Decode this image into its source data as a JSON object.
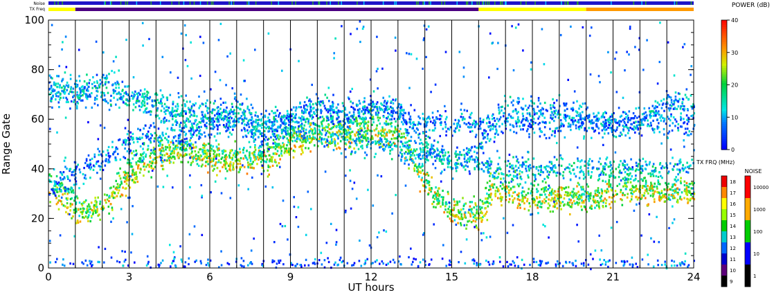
{
  "chart_data": {
    "type": "heatmap",
    "xlabel": "UT hours",
    "ylabel": "Range Gate",
    "xlim": [
      0,
      24
    ],
    "ylim": [
      0,
      100
    ],
    "x_ticks": [
      0,
      3,
      6,
      9,
      12,
      15,
      18,
      21,
      24
    ],
    "x_tick_labels": [
      "0",
      "3",
      "6",
      "9",
      "12",
      "15",
      "18",
      "21",
      "24"
    ],
    "y_ticks": [
      0,
      20,
      40,
      60,
      80,
      100
    ],
    "y_tick_labels": [
      "0",
      "20",
      "40",
      "60",
      "80",
      "100"
    ],
    "hour_lines": [
      1,
      2,
      3,
      4,
      5,
      6,
      7,
      8,
      9,
      10,
      11,
      12,
      13,
      14,
      15,
      16,
      17,
      18,
      19,
      20,
      21,
      22,
      23
    ],
    "grid": false,
    "legend_position": "right",
    "top_bars": {
      "noise_label": "Noise",
      "txfreq_label": "TX Freq",
      "tx_segments": [
        {
          "from": 0,
          "to": 1,
          "color": "#ffff00"
        },
        {
          "from": 1,
          "to": 16,
          "color": "#4b0082"
        },
        {
          "from": 16,
          "to": 20,
          "color": "#ffff00"
        },
        {
          "from": 20,
          "to": 24,
          "color": "#ff9900"
        }
      ]
    },
    "power_colorbar": {
      "title": "POWER (dB)",
      "range": [
        0,
        40
      ],
      "ticks": [
        0,
        10,
        20,
        30,
        40
      ],
      "tick_labels": [
        "0",
        "10",
        "20",
        "30",
        "40"
      ]
    },
    "txfreq_colorbar": {
      "title": "TX FRQ (MHz)",
      "labels": [
        "9",
        "10",
        "11",
        "12",
        "13",
        "14",
        "15",
        "16",
        "17",
        "18"
      ],
      "colors": [
        "#000000",
        "#5c007a",
        "#0000cc",
        "#0066ff",
        "#00cccc",
        "#00cc00",
        "#99ff00",
        "#ffff00",
        "#ff8800",
        "#ee0000"
      ]
    },
    "noise_colorbar": {
      "title": "NOISE",
      "labels": [
        "1",
        "10",
        "100",
        "1000",
        "10000"
      ],
      "colors": [
        "#000000",
        "#0000ff",
        "#00cc00",
        "#ffaa00",
        "#ff0000"
      ]
    },
    "backscatter_bands": [
      {
        "name": "band_a",
        "points": [
          [
            0,
            70
          ],
          [
            1,
            68
          ],
          [
            2,
            76
          ],
          [
            3,
            70
          ],
          [
            4,
            64
          ],
          [
            5,
            57
          ],
          [
            6,
            62
          ],
          [
            7,
            64
          ],
          [
            8,
            58
          ],
          [
            9,
            60
          ],
          [
            10,
            66
          ],
          [
            11,
            62
          ],
          [
            12,
            64
          ],
          [
            13,
            62
          ],
          [
            14,
            50
          ],
          [
            15,
            42
          ],
          [
            16,
            48
          ],
          [
            17,
            66
          ],
          [
            18,
            64
          ],
          [
            19,
            64
          ],
          [
            20,
            62
          ],
          [
            21,
            58
          ],
          [
            22,
            60
          ],
          [
            23,
            66
          ],
          [
            24,
            66
          ]
        ],
        "power": 10
      },
      {
        "name": "band_b",
        "points": [
          [
            0,
            36
          ],
          [
            0.5,
            32
          ],
          [
            1,
            26
          ],
          [
            1.5,
            22
          ],
          [
            2,
            26
          ],
          [
            3,
            42
          ],
          [
            4,
            48
          ],
          [
            5,
            48
          ],
          [
            6,
            46
          ],
          [
            7,
            44
          ],
          [
            8,
            46
          ],
          [
            9,
            54
          ],
          [
            10,
            58
          ],
          [
            11,
            56
          ],
          [
            12,
            58
          ],
          [
            13,
            56
          ],
          [
            13.5,
            46
          ],
          [
            14,
            36
          ],
          [
            14.5,
            28
          ],
          [
            15,
            24
          ],
          [
            15.5,
            22
          ],
          [
            16,
            24
          ],
          [
            16.5,
            34
          ],
          [
            17,
            34
          ],
          [
            18,
            30
          ],
          [
            19,
            30
          ],
          [
            20,
            30
          ],
          [
            20.5,
            28
          ],
          [
            21,
            36
          ],
          [
            22,
            34
          ],
          [
            23,
            32
          ],
          [
            24,
            32
          ]
        ],
        "power": 18
      },
      {
        "name": "band_c",
        "points": [
          [
            0,
            32
          ],
          [
            1,
            22
          ],
          [
            2,
            24
          ],
          [
            3,
            36
          ],
          [
            4,
            44
          ],
          [
            5,
            46
          ],
          [
            6,
            44
          ],
          [
            7,
            42
          ],
          [
            8,
            42
          ],
          [
            9,
            50
          ],
          [
            10,
            54
          ],
          [
            11,
            52
          ],
          [
            12,
            54
          ],
          [
            13,
            52
          ],
          [
            14,
            34
          ],
          [
            15,
            22
          ],
          [
            16,
            20
          ],
          [
            16.5,
            30
          ],
          [
            17,
            30
          ],
          [
            18,
            26
          ],
          [
            19,
            28
          ],
          [
            20,
            26
          ],
          [
            21,
            30
          ],
          [
            22,
            30
          ],
          [
            23,
            30
          ],
          [
            24,
            30
          ]
        ],
        "power": 26
      },
      {
        "name": "band_d",
        "points": [
          [
            16,
            42
          ],
          [
            17,
            40
          ],
          [
            18,
            40
          ],
          [
            19,
            40
          ],
          [
            20,
            40
          ],
          [
            21,
            40
          ],
          [
            22,
            40
          ],
          [
            23,
            40
          ],
          [
            24,
            40
          ]
        ],
        "power": 12
      },
      {
        "name": "band_e",
        "points": [
          [
            3,
            50
          ],
          [
            4,
            56
          ],
          [
            5,
            52
          ],
          [
            6,
            56
          ],
          [
            7,
            60
          ],
          [
            8,
            50
          ],
          [
            9,
            62
          ],
          [
            10,
            64
          ],
          [
            11,
            60
          ],
          [
            12,
            66
          ],
          [
            13,
            64
          ],
          [
            13.5,
            58
          ]
        ],
        "power": 8
      },
      {
        "name": "band_f",
        "points": [
          [
            0,
            2
          ],
          [
            3,
            2
          ],
          [
            6,
            2
          ],
          [
            9,
            2
          ],
          [
            12,
            2
          ],
          [
            15,
            2
          ],
          [
            18,
            2
          ],
          [
            21,
            2
          ],
          [
            24,
            2
          ]
        ],
        "power": 5
      }
    ]
  }
}
